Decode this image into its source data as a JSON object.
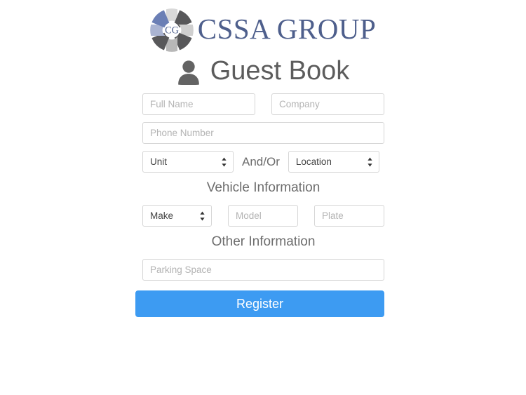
{
  "brand": {
    "logo_icon": "cssa-wheel-logo",
    "monogram": "CG",
    "name_first_letter": "C",
    "name": "CSSA",
    "name_second": "G",
    "name_second_rest": "ROUP",
    "full_name": "CSSA GROUP",
    "text_color": "#4e5f8c",
    "wheel_colors": {
      "light_gray": "#d9d9d9",
      "mid_gray": "#b0b0b0",
      "dark_gray": "#58585a",
      "blue": "#6b7fb5",
      "light_blue": "#aab4d2"
    }
  },
  "header": {
    "icon": "user-icon",
    "title": "Guest Book",
    "title_color": "#5c5c5c"
  },
  "form": {
    "full_name": {
      "placeholder": "Full Name",
      "value": ""
    },
    "company": {
      "placeholder": "Company",
      "value": ""
    },
    "phone_number": {
      "placeholder": "Phone Number",
      "value": ""
    },
    "unit": {
      "selected": "Unit",
      "options": [
        "Unit"
      ]
    },
    "and_or_label": "And/Or",
    "location": {
      "selected": "Location",
      "options": [
        "Location"
      ]
    },
    "vehicle_section_title": "Vehicle Information",
    "make": {
      "selected": "Make",
      "options": [
        "Make"
      ]
    },
    "model": {
      "placeholder": "Model",
      "value": ""
    },
    "plate": {
      "placeholder": "Plate",
      "value": ""
    },
    "other_section_title": "Other Information",
    "parking_space": {
      "placeholder": "Parking Space",
      "value": ""
    },
    "submit_label": "Register",
    "submit_color": "#3d9bf2"
  }
}
